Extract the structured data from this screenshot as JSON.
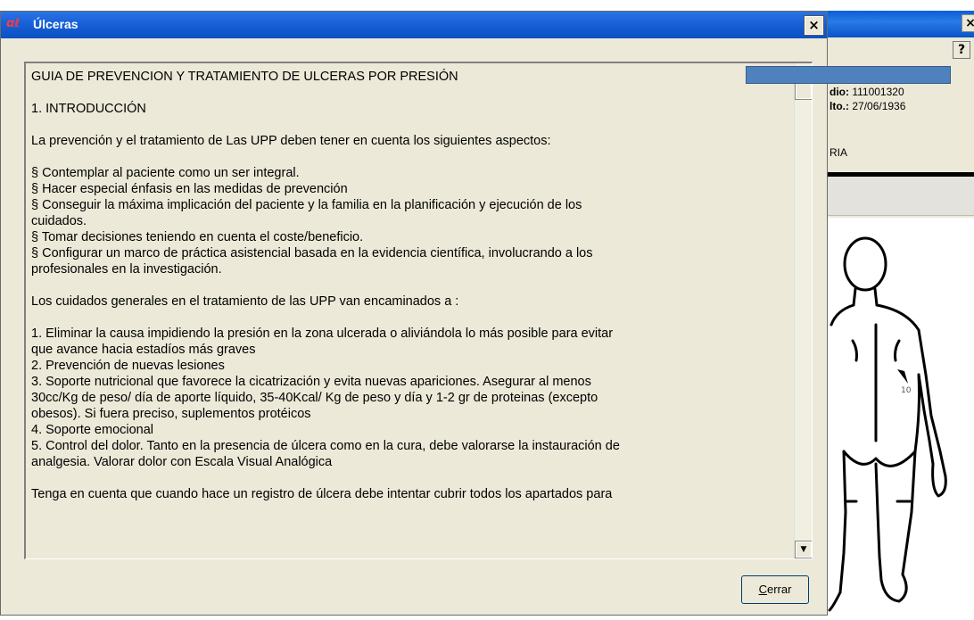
{
  "dialog": {
    "title": "Úlceras",
    "app_icon": "app-logo-icon",
    "close_label": "×",
    "cerrar_button": {
      "accelerator": "C",
      "rest": "errar"
    },
    "text_lines": [
      "GUIA DE PREVENCION Y TRATAMIENTO DE ULCERAS POR PRESIÓN",
      "",
      "1. INTRODUCCIÓN",
      "",
      "La prevención y el tratamiento de Las UPP deben tener en cuenta los siguientes aspectos:",
      "",
      "§ Contemplar al paciente como un ser integral.",
      "§ Hacer especial énfasis en las medidas de prevención",
      "§ Conseguir la máxima implicación del paciente y la familia en la planificación y ejecución de los",
      "cuidados.",
      "§ Tomar decisiones teniendo en cuenta el coste/beneficio.",
      "§ Configurar un marco de práctica asistencial basada en la evidencia científica, involucrando a los",
      "profesionales en la investigación.",
      "",
      "Los cuidados generales en el tratamiento de las UPP  van encaminados a :",
      "",
      "1. Eliminar la causa impidiendo la presión en la zona ulcerada o aliviándola lo más posible para evitar",
      "que avance hacia estadíos más graves",
      "2. Prevención de nuevas lesiones",
      "3. Soporte nutricional que favorece la cicatrización y evita nuevas apariciones. Asegurar al menos",
      "30cc/Kg de peso/ día de aporte líquido,  35-40Kcal/ Kg de peso y día y 1-2 gr de proteinas (excepto",
      "obesos). Si fuera preciso, suplementos protéicos",
      "4. Soporte emocional",
      "5. Control del dolor. Tanto en la presencia de úlcera como en la cura, debe valorarse la instauración de",
      "analgesia. Valorar dolor con Escala Visual Analógica",
      "",
      "Tenga en cuenta que cuando hace un registro de úlcera debe intentar cubrir todos los apartados para"
    ]
  },
  "background_window": {
    "close_label": "×",
    "help_label": "?",
    "field1_label": "dio:",
    "field1_value": "111001320",
    "field2_label": "lto.:",
    "field2_value": "27/06/1936",
    "partial_text": "RIA"
  },
  "colors": {
    "titlebar": "#1a62d8",
    "dialog_bg": "#ece9d8",
    "overlay_bar": "#4f81bd"
  }
}
